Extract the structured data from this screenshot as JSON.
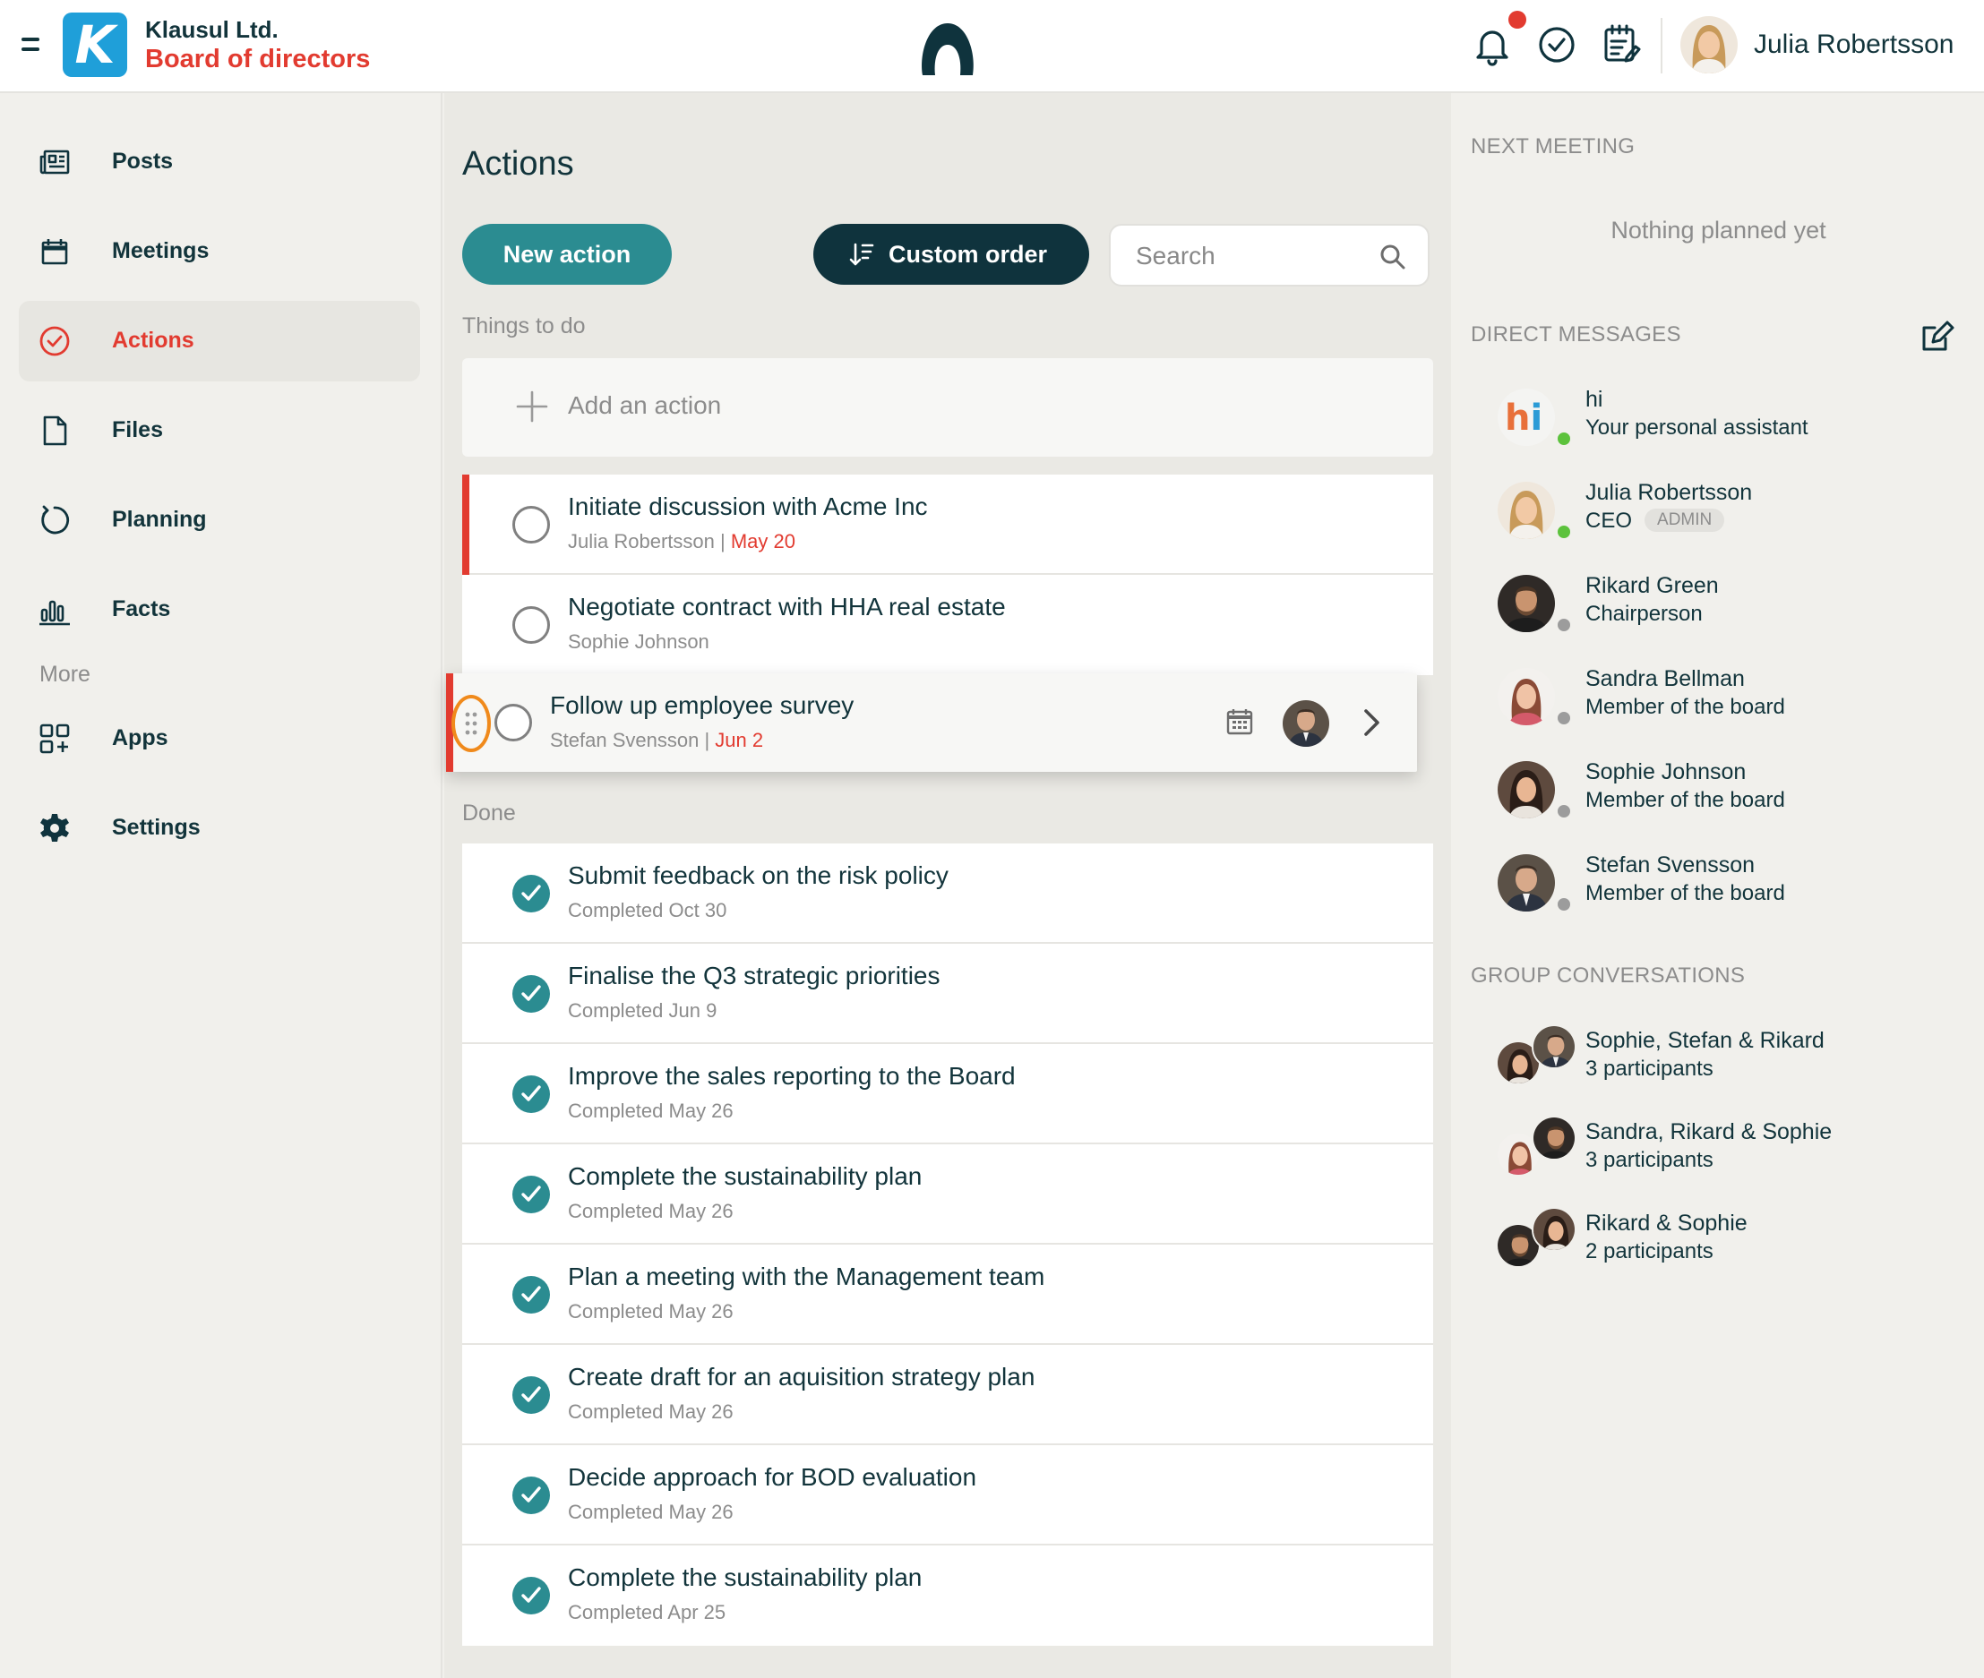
{
  "header": {
    "org_name": "Klausul Ltd.",
    "board_name": "Board of directors",
    "logo_letter": "K",
    "user_name": "Julia Robertsson",
    "notification_dot": true
  },
  "colors": {
    "accent": "#e23b30",
    "teal": "#2b8c91",
    "dark": "#0f333d",
    "online": "#5cc23c",
    "highlight": "#f08a1c"
  },
  "sidebar": {
    "items": [
      {
        "label": "Posts",
        "icon": "newspaper-icon"
      },
      {
        "label": "Meetings",
        "icon": "calendar-icon"
      },
      {
        "label": "Actions",
        "icon": "check-circle-icon",
        "active": true
      },
      {
        "label": "Files",
        "icon": "file-icon"
      },
      {
        "label": "Planning",
        "icon": "cycle-icon"
      },
      {
        "label": "Facts",
        "icon": "bar-chart-icon"
      }
    ],
    "more_label": "More",
    "more_items": [
      {
        "label": "Apps",
        "icon": "apps-icon"
      },
      {
        "label": "Settings",
        "icon": "gear-icon"
      }
    ]
  },
  "main": {
    "title": "Actions",
    "new_action_label": "New action",
    "order_label": "Custom order",
    "search_placeholder": "Search",
    "todo_label": "Things to do",
    "add_action_label": "Add an action",
    "todo": [
      {
        "title": "Initiate discussion with Acme Inc",
        "assignee": "Julia Robertsson",
        "sep": " | ",
        "date": "May 20",
        "priority": true
      },
      {
        "title": "Negotiate contract with HHA real estate",
        "assignee": "Sophie Johnson",
        "sep": "",
        "date": "",
        "priority": false
      }
    ],
    "dragging": {
      "title": "Follow up employee survey",
      "assignee": "Stefan Svensson",
      "sep": " | ",
      "date": "Jun 2"
    },
    "done_label": "Done",
    "done": [
      {
        "title": "Submit feedback on the risk policy",
        "status": "Completed Oct 30"
      },
      {
        "title": "Finalise the Q3 strategic priorities",
        "status": "Completed Jun 9"
      },
      {
        "title": "Improve the sales reporting to the Board",
        "status": "Completed May 26"
      },
      {
        "title": "Complete the sustainability plan",
        "status": "Completed May 26"
      },
      {
        "title": "Plan a meeting with the Management team",
        "status": "Completed May 26"
      },
      {
        "title": "Create draft for an aquisition strategy plan",
        "status": "Completed May 26"
      },
      {
        "title": "Decide approach for BOD evaluation",
        "status": "Completed May 26"
      },
      {
        "title": "Complete the sustainability plan",
        "status": "Completed Apr 25"
      }
    ]
  },
  "right_panel": {
    "next_meeting_label": "NEXT MEETING",
    "next_meeting_empty": "Nothing planned yet",
    "dm_label": "DIRECT MESSAGES",
    "people": [
      {
        "name": "hi",
        "role": "Your personal assistant",
        "badge": "",
        "online": true
      },
      {
        "name": "Julia Robertsson",
        "role": "CEO",
        "badge": "ADMIN",
        "online": true
      },
      {
        "name": "Rikard Green",
        "role": "Chairperson",
        "badge": "",
        "online": false
      },
      {
        "name": "Sandra Bellman",
        "role": "Member of the board",
        "badge": "",
        "online": false
      },
      {
        "name": "Sophie Johnson",
        "role": "Member of the board",
        "badge": "",
        "online": false
      },
      {
        "name": "Stefan Svensson",
        "role": "Member of the board",
        "badge": "",
        "online": false
      }
    ],
    "group_label": "GROUP CONVERSATIONS",
    "groups": [
      {
        "name": "Sophie, Stefan & Rikard",
        "count": "3 participants"
      },
      {
        "name": "Sandra, Rikard & Sophie",
        "count": "3 participants"
      },
      {
        "name": "Rikard & Sophie",
        "count": "2 participants"
      }
    ]
  }
}
